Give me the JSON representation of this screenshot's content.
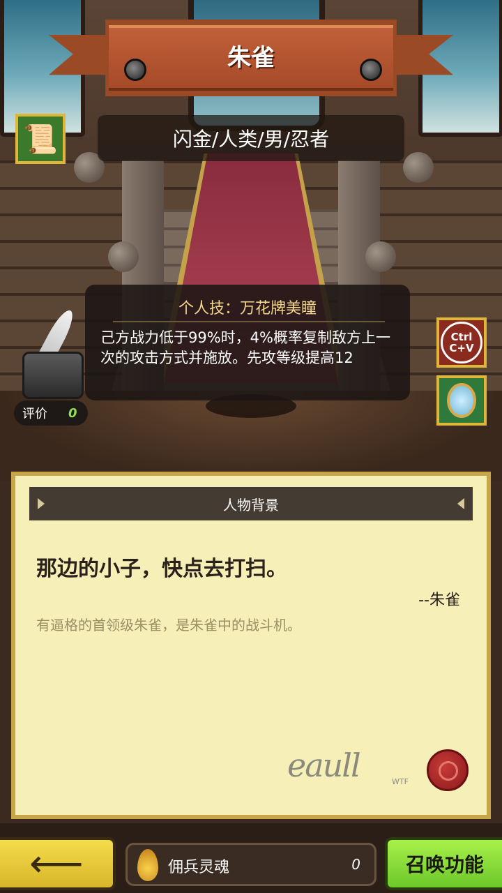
{
  "character": {
    "name": "朱雀",
    "info": "闪金/人类/男/忍者"
  },
  "skill": {
    "title": "个人技：万花牌美瞳",
    "description": "己方战力低于99%时，4%概率复制敌方上一次的攻击方式并施放。先攻等级提高12"
  },
  "rating": {
    "label": "评价",
    "value": "0"
  },
  "side_buttons": {
    "ctrl_cv_top": "Ctrl",
    "ctrl_cv_bottom": "C+V"
  },
  "background_panel": {
    "header": "人物背景",
    "quote": "那边的小子，快点去打扫。",
    "quote_author": "--朱雀",
    "bio": "有逼格的首领级朱雀，是朱雀中的战斗机。",
    "signature_sub": "WTF"
  },
  "bottom_bar": {
    "soul_label": "佣兵灵魂",
    "soul_value": "0",
    "summon_label": "召唤功能"
  },
  "icons": {
    "scroll": "scroll-icon",
    "ink": "inkwell-quill-icon",
    "mirror": "hand-mirror-icon",
    "soul": "flame-soul-icon",
    "back": "left-arrow-icon"
  },
  "colors": {
    "banner": "#a64a28",
    "accent_gold": "#e0b63a",
    "summon_green": "#8ce03a",
    "back_yellow": "#f0d640",
    "rating_value": "#8ee05a"
  }
}
